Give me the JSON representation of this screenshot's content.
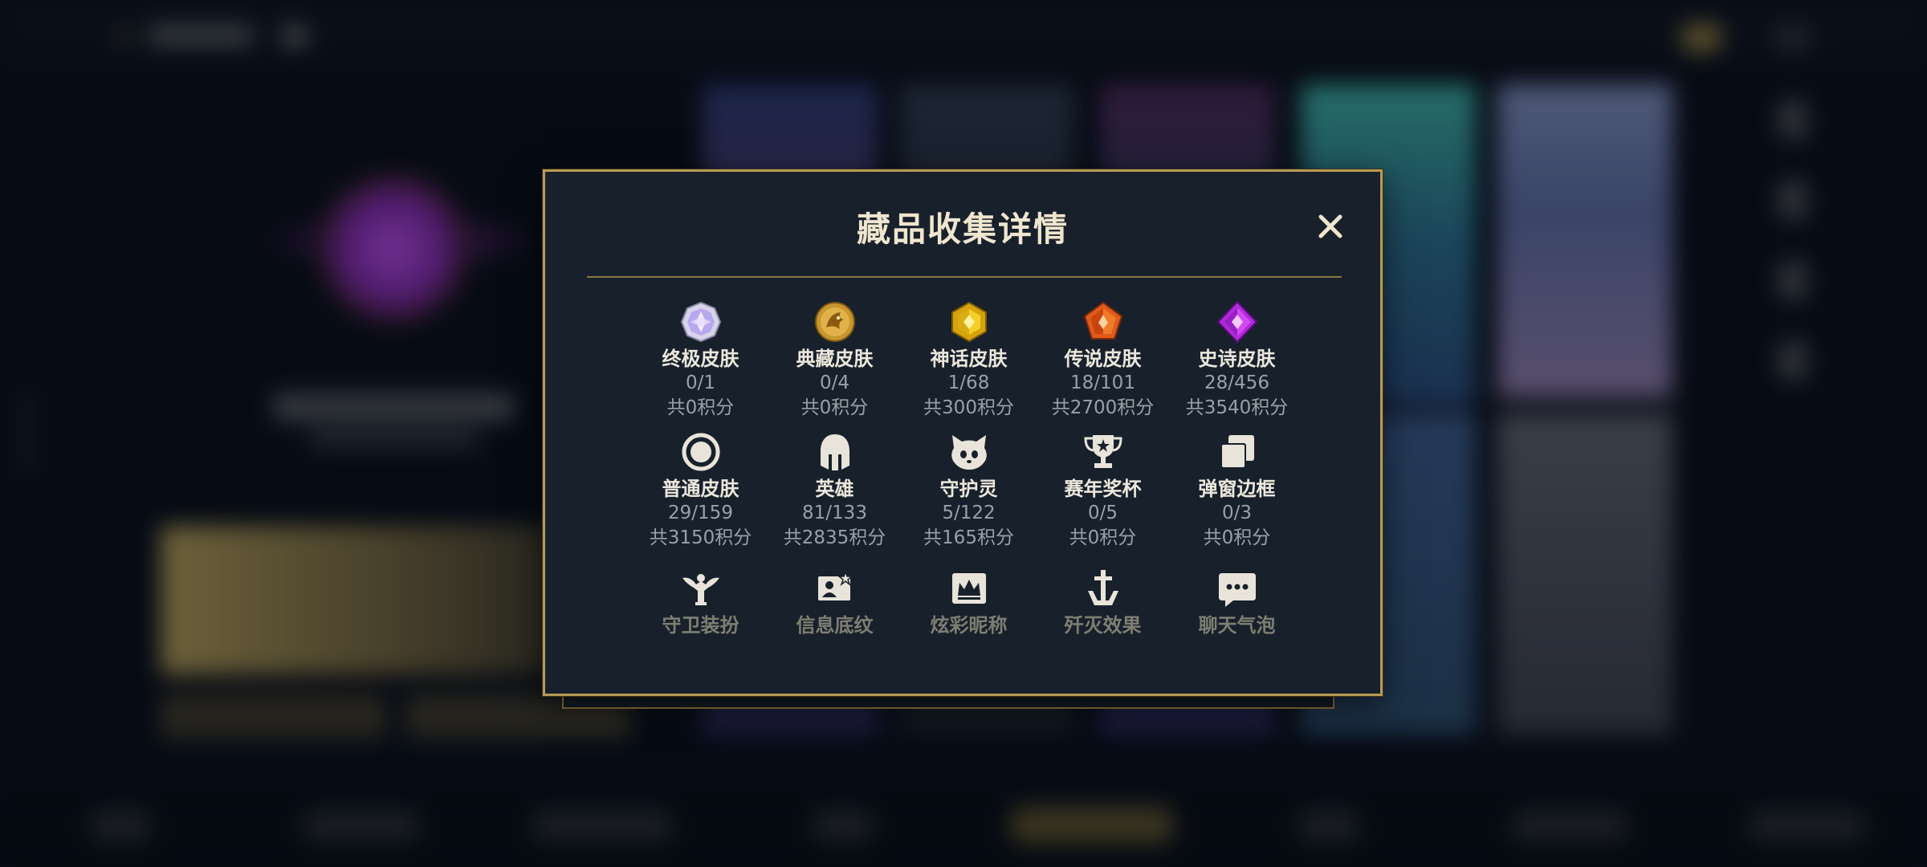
{
  "modal": {
    "title": "藏品收集详情",
    "close_icon": "close-icon",
    "items": [
      {
        "name": "终极皮肤",
        "count": "0/1",
        "score": "共0积分",
        "icon": "ultimate-skin-icon"
      },
      {
        "name": "典藏皮肤",
        "count": "0/4",
        "score": "共0积分",
        "icon": "collector-skin-icon"
      },
      {
        "name": "神话皮肤",
        "count": "1/68",
        "score": "共300积分",
        "icon": "mythic-skin-icon"
      },
      {
        "name": "传说皮肤",
        "count": "18/101",
        "score": "共2700积分",
        "icon": "legendary-skin-icon"
      },
      {
        "name": "史诗皮肤",
        "count": "28/456",
        "score": "共3540积分",
        "icon": "epic-skin-icon"
      },
      {
        "name": "普通皮肤",
        "count": "29/159",
        "score": "共3150积分",
        "icon": "normal-skin-icon"
      },
      {
        "name": "英雄",
        "count": "81/133",
        "score": "共2835积分",
        "icon": "hero-helmet-icon"
      },
      {
        "name": "守护灵",
        "count": "5/122",
        "score": "共165积分",
        "icon": "guardian-spirit-icon"
      },
      {
        "name": "赛年奖杯",
        "count": "0/5",
        "score": "共0积分",
        "icon": "season-trophy-icon"
      },
      {
        "name": "弹窗边框",
        "count": "0/3",
        "score": "共0积分",
        "icon": "popup-frame-icon"
      },
      {
        "name": "守卫装扮",
        "icon": "ward-skin-icon"
      },
      {
        "name": "信息底纹",
        "icon": "info-card-icon"
      },
      {
        "name": "炫彩昵称",
        "icon": "colorful-name-icon"
      },
      {
        "name": "歼灭效果",
        "icon": "kill-effect-icon"
      },
      {
        "name": "聊天气泡",
        "icon": "chat-bubble-icon"
      }
    ]
  },
  "colors": {
    "accent_gold": "#b79a55",
    "modal_bg": "#18212b",
    "text_main": "#ece7dd",
    "text_sub": "#9aa0a8"
  }
}
